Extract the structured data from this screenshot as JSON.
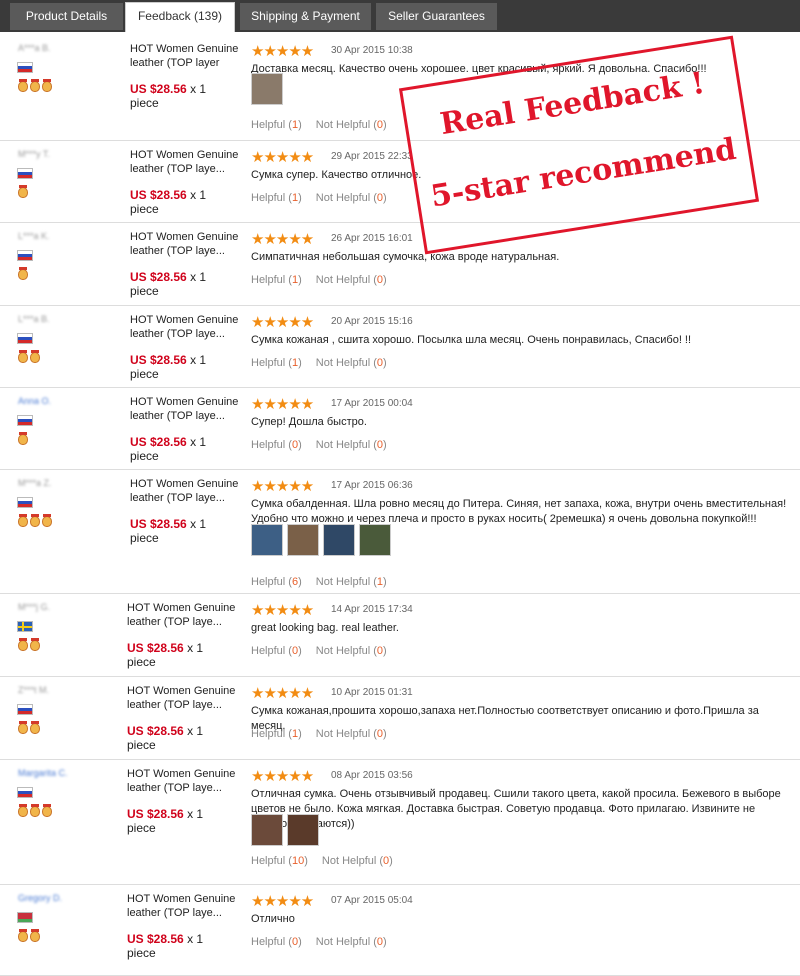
{
  "tabs": [
    {
      "label": "Product Details"
    },
    {
      "label": "Feedback (139)"
    },
    {
      "label": "Shipping & Payment"
    },
    {
      "label": "Seller Guarantees"
    }
  ],
  "stamp": {
    "line1": "Real Feedback !",
    "line2": "5-star recommend"
  },
  "reviews": [
    {
      "user": "A***a B.",
      "flag": "ru",
      "medals": 3,
      "product": "HOT Women Genuine leather (TOP layer",
      "price": "US $28.56",
      "qty": "x 1",
      "unit": "piece",
      "stars": "★★★★★",
      "date": "30 Apr 2015 10:38",
      "text": "Доставка месяц. Качество очень хорошее. цвет красивый, яркий. Я довольна. Спасибо!!!",
      "thumbs": [
        "#8a7a6a"
      ],
      "helpful_label": "Helpful (",
      "helpful": "1",
      "not_helpful_label": "Not Helpful (",
      "not_helpful": "0",
      "close": ")"
    },
    {
      "user": "M***y T.",
      "flag": "ru",
      "medals": 1,
      "product": "HOT Women Genuine leather (TOP laye...",
      "price": "US $28.56",
      "qty": "x 1",
      "unit": "piece",
      "stars": "★★★★★",
      "date": "29 Apr 2015 22:33",
      "text": "Сумка супер. Качество отличное.",
      "thumbs": [],
      "helpful_label": "Helpful (",
      "helpful": "1",
      "not_helpful_label": "Not Helpful (",
      "not_helpful": "0",
      "close": ")"
    },
    {
      "user": "L***a K.",
      "flag": "ru",
      "medals": 1,
      "product": "HOT Women Genuine leather (TOP laye...",
      "price": "US $28.56",
      "qty": "x 1",
      "unit": "piece",
      "stars": "★★★★★",
      "date": "26 Apr 2015 16:01",
      "text": "Симпатичная небольшая сумочка, кожа вроде натуральная.",
      "thumbs": [],
      "helpful_label": "Helpful (",
      "helpful": "1",
      "not_helpful_label": "Not Helpful (",
      "not_helpful": "0",
      "close": ")"
    },
    {
      "user": "L***a B.",
      "flag": "ru",
      "medals": 2,
      "product": "HOT Women Genuine leather (TOP laye...",
      "price": "US $28.56",
      "qty": "x 1",
      "unit": "piece",
      "stars": "★★★★★",
      "date": "20 Apr 2015 15:16",
      "text": "Сумка кожаная , сшита хорошо. Посылка шла месяц. Очень понравилась, Спасибо! !!",
      "thumbs": [],
      "helpful_label": "Helpful (",
      "helpful": "1",
      "not_helpful_label": "Not Helpful (",
      "not_helpful": "0",
      "close": ")"
    },
    {
      "user": "Anna O.",
      "userBlue": true,
      "flag": "ru",
      "medals": 1,
      "product": "HOT Women Genuine leather (TOP laye...",
      "price": "US $28.56",
      "qty": "x 1",
      "unit": "piece",
      "stars": "★★★★★",
      "date": "17 Apr 2015 00:04",
      "text": "Супер! Дошла быстро.",
      "thumbs": [],
      "helpful_label": "Helpful (",
      "helpful": "0",
      "not_helpful_label": "Not Helpful (",
      "not_helpful": "0",
      "close": ")"
    },
    {
      "user": "M***a Z.",
      "flag": "ru",
      "medals": 3,
      "product": "HOT Women Genuine leather (TOP laye...",
      "price": "US $28.56",
      "qty": "x 1",
      "unit": "piece",
      "stars": "★★★★★",
      "date": "17 Apr 2015 06:36",
      "text": "Сумка обалденная. Шла ровно месяц до Питера. Синяя, нет запаха, кожа, внутри очень вместительная! Удобно что можно и через плеча и просто в руках носить( 2ремешка) я очень довольна покупкой!!!",
      "thumbs": [
        "#3d5f85",
        "#7a6048",
        "#2f4866",
        "#4a5a3a"
      ],
      "helpful_label": "Helpful (",
      "helpful": "6",
      "not_helpful_label": "Not Helpful (",
      "not_helpful": "1",
      "close": ")"
    },
    {
      "user": "M***j G.",
      "flag": "se",
      "medals": 2,
      "product": "HOT Women Genuine leather (TOP laye...",
      "price": "US $28.56",
      "qty": "x 1",
      "unit": "piece",
      "stars": "★★★★★",
      "date": "14 Apr 2015 17:34",
      "text": "great looking bag. real leather.",
      "thumbs": [],
      "helpful_label": "Helpful (",
      "helpful": "0",
      "not_helpful_label": "Not Helpful (",
      "not_helpful": "0",
      "close": ")"
    },
    {
      "user": "Z***t M.",
      "flag": "ru",
      "medals": 2,
      "product": "HOT Women Genuine leather (TOP laye...",
      "price": "US $28.56",
      "qty": "x 1",
      "unit": "piece",
      "stars": "★★★★★",
      "date": "10 Apr 2015 01:31",
      "text": "Сумка кожаная,прошита хорошо,запаха нет.Полностью соответствует описанию и фото.Пришла за месяц.",
      "thumbs": [],
      "helpful_label": "Helpful (",
      "helpful": "1",
      "not_helpful_label": "Not Helpful (",
      "not_helpful": "0",
      "close": ")"
    },
    {
      "user": "Margarita C.",
      "userBlue": true,
      "flag": "ru",
      "medals": 3,
      "product": "HOT Women Genuine leather (TOP laye...",
      "price": "US $28.56",
      "qty": "x 1",
      "unit": "piece",
      "stars": "★★★★★",
      "date": "08 Apr 2015 03:56",
      "text": "Отличная сумка. Очень отзывчивый продавец. Сшили такого цвета, какой просила. Бежевого в выборе цветов не было. Кожа мягкая. Доставка быстрая. Советую продавца. Фото прилагаю. Извините не переворачиваются))",
      "thumbs": [
        "#6b4a3a",
        "#5a3a2a"
      ],
      "helpful_label": "Helpful (",
      "helpful": "10",
      "not_helpful_label": "Not Helpful (",
      "not_helpful": "0",
      "close": ")"
    },
    {
      "user": "Gregory D.",
      "userBlue": true,
      "flag": "by",
      "medals": 2,
      "product": "HOT Women Genuine leather (TOP laye...",
      "price": "US $28.56",
      "qty": "x 1",
      "unit": "piece",
      "stars": "★★★★★",
      "date": "07 Apr 2015 05:04",
      "text": "Отлично",
      "thumbs": [],
      "helpful_label": "Helpful (",
      "helpful": "0",
      "not_helpful_label": "Not Helpful (",
      "not_helpful": "0",
      "close": ")"
    }
  ]
}
